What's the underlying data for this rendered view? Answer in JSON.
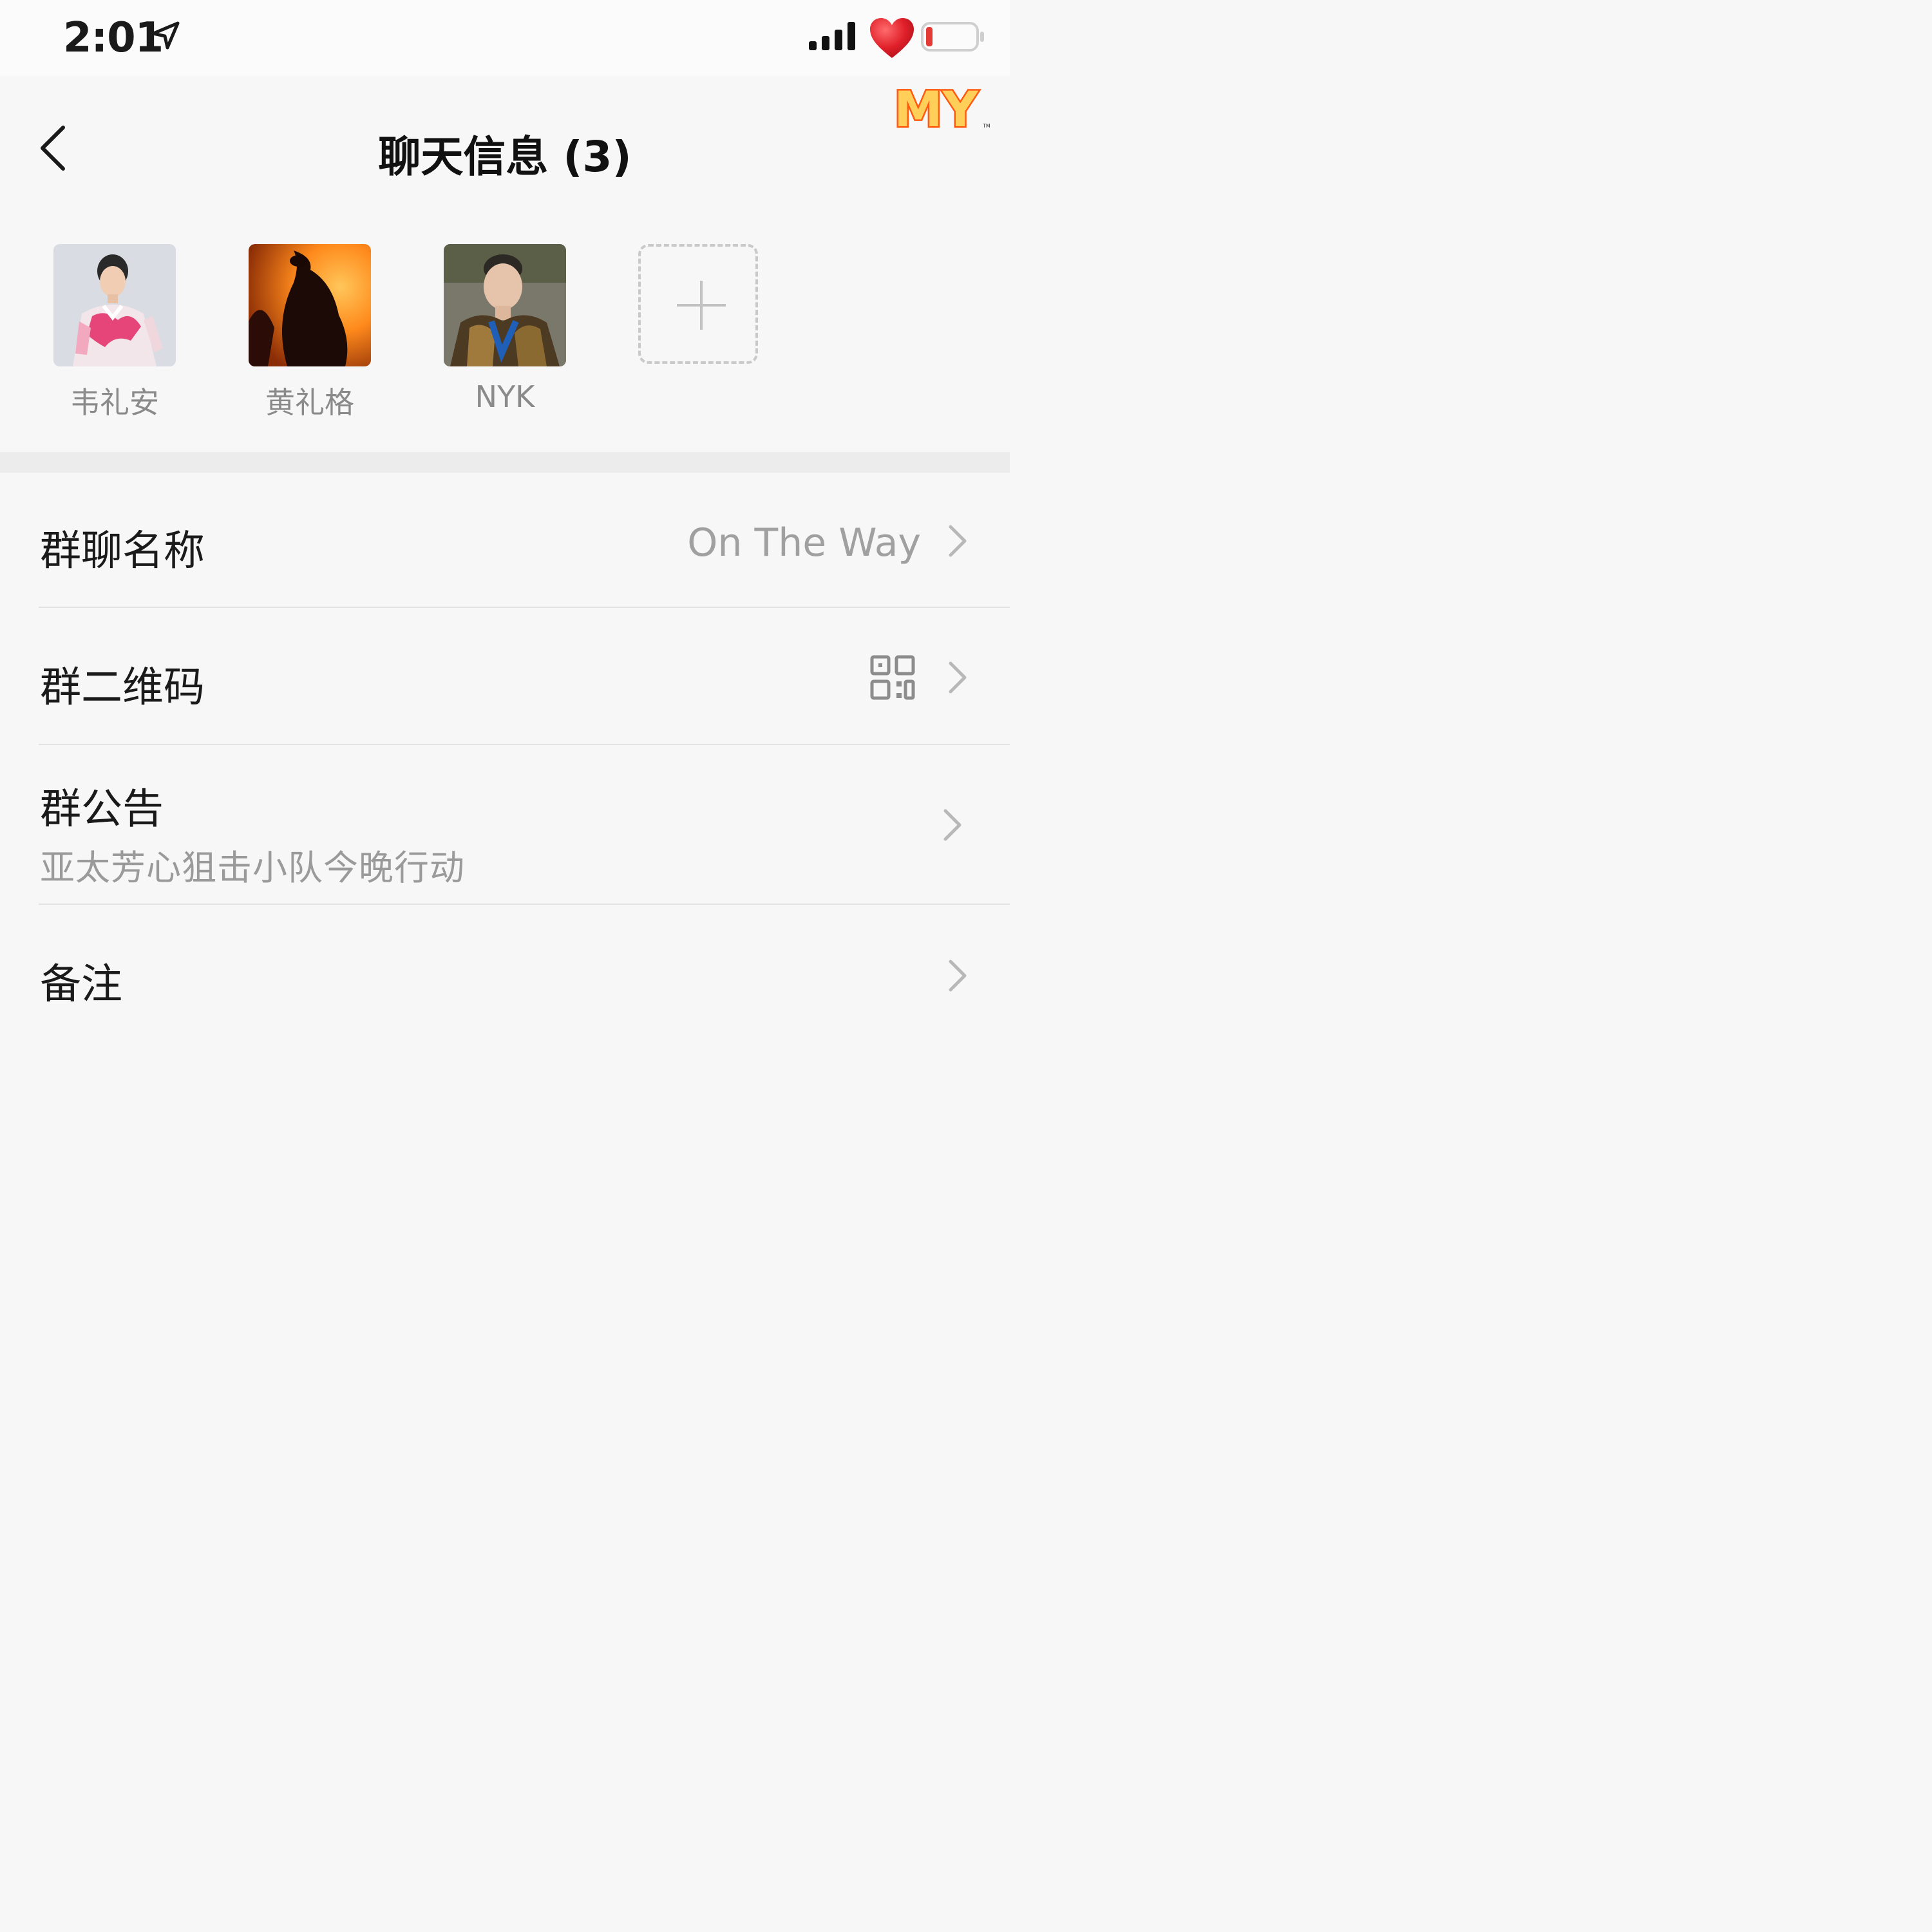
{
  "status_bar": {
    "time": "2:01"
  },
  "header": {
    "title": "聊天信息 (3)",
    "sticker_text": "MY"
  },
  "members": [
    {
      "name": "韦礼安"
    },
    {
      "name": "黄礼格"
    },
    {
      "name": "NYK"
    }
  ],
  "settings": {
    "group_name": {
      "label": "群聊名称",
      "value": "On The Way"
    },
    "qr_code": {
      "label": "群二维码"
    },
    "announcement": {
      "label": "群公告",
      "value": "亚太芳心狙击小队今晚行动"
    },
    "remark": {
      "label": "备注"
    }
  },
  "colors": {
    "background": "#f7f7f7",
    "section_gap": "#ececec",
    "secondary_text": "#9a9a9a",
    "heart": "#e0202a",
    "battery_low": "#e53935",
    "sticker_orange": "#ff6a1a"
  }
}
